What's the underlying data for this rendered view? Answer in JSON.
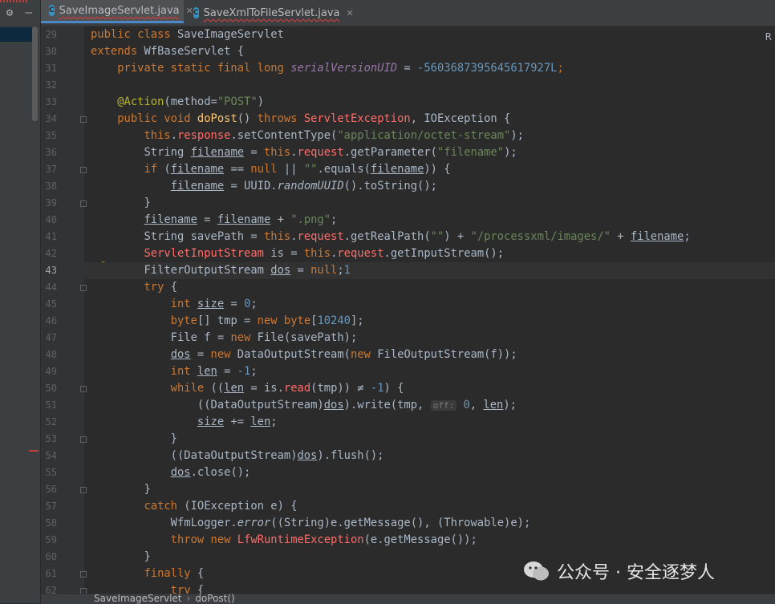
{
  "tabs": [
    {
      "label": "SaveImageServlet.java",
      "active": true
    },
    {
      "label": "SaveXmlToFileServlet.java",
      "active": false
    }
  ],
  "right_marker": "R",
  "lines": [
    {
      "n": "29",
      "tokens": [
        [
          "public class ",
          "kw"
        ],
        [
          "SaveImageServlet",
          ""
        ]
      ]
    },
    {
      "n": "30",
      "tokens": [
        [
          "extends ",
          "kw"
        ],
        [
          "WfBaseServlet {",
          ""
        ]
      ]
    },
    {
      "n": "31",
      "tokens": [
        [
          "    private static final long ",
          "kw"
        ],
        [
          "serialVersionUID",
          "fldi"
        ],
        [
          " = ",
          ""
        ],
        [
          "-5603687395645617927L",
          "num"
        ],
        [
          ";",
          "kw"
        ]
      ]
    },
    {
      "n": "32",
      "tokens": []
    },
    {
      "n": "33",
      "tokens": [
        [
          "    ",
          ""
        ],
        [
          "@Action",
          "ann"
        ],
        [
          "(method=",
          ""
        ],
        [
          "\"POST\"",
          "str"
        ],
        [
          ")",
          ""
        ]
      ]
    },
    {
      "n": "34",
      "tokens": [
        [
          "    public void ",
          "kw"
        ],
        [
          "doPost",
          "fn"
        ],
        [
          "() ",
          ""
        ],
        [
          "throws ",
          "kw"
        ],
        [
          "ServletException",
          "err"
        ],
        [
          ", IOException {",
          ""
        ]
      ]
    },
    {
      "n": "35",
      "tokens": [
        [
          "        this",
          "kw"
        ],
        [
          ".",
          ""
        ],
        [
          "response",
          "err"
        ],
        [
          ".setContentType(",
          ""
        ],
        [
          "\"application/octet-stream\"",
          "str"
        ],
        [
          ");",
          ""
        ]
      ]
    },
    {
      "n": "36",
      "tokens": [
        [
          "        String ",
          ""
        ],
        [
          "filename",
          "ul"
        ],
        [
          " = ",
          ""
        ],
        [
          "this",
          "kw"
        ],
        [
          ".",
          ""
        ],
        [
          "request",
          "err"
        ],
        [
          ".getParameter(",
          ""
        ],
        [
          "\"filename\"",
          "str"
        ],
        [
          ");",
          ""
        ]
      ]
    },
    {
      "n": "37",
      "tokens": [
        [
          "        if ",
          "kw"
        ],
        [
          "(",
          ""
        ],
        [
          "filename",
          "ul"
        ],
        [
          " == ",
          ""
        ],
        [
          "null",
          "kw"
        ],
        [
          " || ",
          ""
        ],
        [
          "\"\"",
          "str"
        ],
        [
          ".equals(",
          ""
        ],
        [
          "filename",
          "ul"
        ],
        [
          ")) {",
          ""
        ]
      ]
    },
    {
      "n": "38",
      "tokens": [
        [
          "            ",
          ""
        ],
        [
          "filename",
          "ul"
        ],
        [
          " = UUID.",
          ""
        ],
        [
          "randomUUID",
          "it"
        ],
        [
          "().toString();",
          ""
        ]
      ]
    },
    {
      "n": "39",
      "tokens": [
        [
          "        }",
          ""
        ]
      ]
    },
    {
      "n": "40",
      "tokens": [
        [
          "        ",
          ""
        ],
        [
          "filename",
          "ul"
        ],
        [
          " = ",
          ""
        ],
        [
          "filename",
          "ul"
        ],
        [
          " + ",
          ""
        ],
        [
          "\".png\"",
          "str"
        ],
        [
          ";",
          ""
        ]
      ]
    },
    {
      "n": "41",
      "tokens": [
        [
          "        String savePath = ",
          ""
        ],
        [
          "this",
          "kw"
        ],
        [
          ".",
          ""
        ],
        [
          "request",
          "err"
        ],
        [
          ".getRealPath(",
          ""
        ],
        [
          "\"\"",
          "str"
        ],
        [
          ") + ",
          ""
        ],
        [
          "\"/processxml/images/\"",
          "str"
        ],
        [
          " + ",
          ""
        ],
        [
          "filename",
          "ul"
        ],
        [
          ";",
          ""
        ]
      ]
    },
    {
      "n": "42",
      "tokens": [
        [
          "        ",
          ""
        ],
        [
          "ServletInputStream",
          "err"
        ],
        [
          " is = ",
          ""
        ],
        [
          "this",
          "kw"
        ],
        [
          ".",
          ""
        ],
        [
          "request",
          "err"
        ],
        [
          ".getInputStream();",
          ""
        ]
      ]
    },
    {
      "n": "43",
      "tokens": [
        [
          "        FilterOutputStream ",
          ""
        ],
        [
          "dos",
          "ul"
        ],
        [
          " = ",
          ""
        ],
        [
          "null",
          "kw"
        ],
        [
          ";",
          ""
        ],
        [
          "1",
          "num"
        ]
      ]
    },
    {
      "n": "44",
      "tokens": [
        [
          "        try ",
          "kw"
        ],
        [
          "{",
          ""
        ]
      ]
    },
    {
      "n": "45",
      "tokens": [
        [
          "            int ",
          "kw"
        ],
        [
          "size",
          "ul"
        ],
        [
          " = ",
          ""
        ],
        [
          "0",
          "num"
        ],
        [
          ";",
          ""
        ]
      ]
    },
    {
      "n": "46",
      "tokens": [
        [
          "            byte",
          "kw"
        ],
        [
          "[] tmp = ",
          ""
        ],
        [
          "new byte",
          "kw"
        ],
        [
          "[",
          ""
        ],
        [
          "10240",
          "num"
        ],
        [
          "];",
          ""
        ]
      ]
    },
    {
      "n": "47",
      "tokens": [
        [
          "            File f = ",
          ""
        ],
        [
          "new ",
          "kw"
        ],
        [
          "File(savePath);",
          ""
        ]
      ]
    },
    {
      "n": "48",
      "tokens": [
        [
          "            ",
          ""
        ],
        [
          "dos",
          "ul"
        ],
        [
          " = ",
          ""
        ],
        [
          "new ",
          "kw"
        ],
        [
          "DataOutputStream(",
          ""
        ],
        [
          "new ",
          "kw"
        ],
        [
          "FileOutputStream(f));",
          ""
        ]
      ]
    },
    {
      "n": "49",
      "tokens": [
        [
          "            int ",
          "kw"
        ],
        [
          "len",
          "ul"
        ],
        [
          " = ",
          ""
        ],
        [
          "-1",
          "num"
        ],
        [
          ";",
          ""
        ]
      ]
    },
    {
      "n": "50",
      "tokens": [
        [
          "            while ",
          "kw"
        ],
        [
          "((",
          ""
        ],
        [
          "len",
          "ul"
        ],
        [
          " = is.",
          ""
        ],
        [
          "read",
          "err"
        ],
        [
          "(tmp)) ≠ ",
          ""
        ],
        [
          "-1",
          "num"
        ],
        [
          ") {",
          ""
        ]
      ]
    },
    {
      "n": "51",
      "tokens": [
        [
          "                ((DataOutputStream)",
          ""
        ],
        [
          "dos",
          "ul"
        ],
        [
          ").write(tmp, ",
          ""
        ],
        [
          "off:",
          "hint"
        ],
        [
          " ",
          ""
        ],
        [
          "0",
          "num"
        ],
        [
          ", ",
          ""
        ],
        [
          "len",
          "ul"
        ],
        [
          ");",
          ""
        ]
      ]
    },
    {
      "n": "52",
      "tokens": [
        [
          "                ",
          ""
        ],
        [
          "size",
          "ul"
        ],
        [
          " += ",
          ""
        ],
        [
          "len",
          "ul"
        ],
        [
          ";",
          ""
        ]
      ]
    },
    {
      "n": "53",
      "tokens": [
        [
          "            }",
          ""
        ]
      ]
    },
    {
      "n": "54",
      "tokens": [
        [
          "            ((DataOutputStream)",
          ""
        ],
        [
          "dos",
          "ul"
        ],
        [
          ").flush();",
          ""
        ]
      ]
    },
    {
      "n": "55",
      "tokens": [
        [
          "            ",
          ""
        ],
        [
          "dos",
          "ul"
        ],
        [
          ".close();",
          ""
        ]
      ]
    },
    {
      "n": "56",
      "tokens": [
        [
          "        }",
          ""
        ]
      ]
    },
    {
      "n": "57",
      "tokens": [
        [
          "        catch ",
          "kw"
        ],
        [
          "(IOException e) {",
          ""
        ]
      ]
    },
    {
      "n": "58",
      "tokens": [
        [
          "            WfmLogger.",
          ""
        ],
        [
          "error",
          "it"
        ],
        [
          "((String)e.getMessage(), (Throwable)e);",
          ""
        ]
      ]
    },
    {
      "n": "59",
      "tokens": [
        [
          "            throw new ",
          "kw"
        ],
        [
          "LfwRuntimeException",
          "err"
        ],
        [
          "(e.getMessage());",
          ""
        ]
      ]
    },
    {
      "n": "60",
      "tokens": [
        [
          "        }",
          ""
        ]
      ]
    },
    {
      "n": "61",
      "tokens": [
        [
          "        finally ",
          "kw"
        ],
        [
          "{",
          ""
        ]
      ]
    },
    {
      "n": "62",
      "tokens": [
        [
          "            try ",
          "kw"
        ],
        [
          "{",
          ""
        ]
      ]
    }
  ],
  "current_line": "43",
  "breadcrumb": [
    "SaveImageServlet",
    "doPost()"
  ],
  "watermark": "公众号 · 安全逐梦人"
}
